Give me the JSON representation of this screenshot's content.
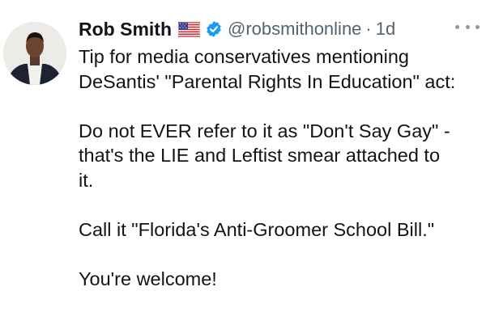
{
  "tweet": {
    "author": {
      "display_name": "Rob Smith",
      "flag_icon": "us-flag-icon",
      "verified_icon": "verified-badge-icon",
      "handle": "@robsmithonline",
      "separator": "·",
      "timestamp": "1d"
    },
    "more_icon": "more-options-icon",
    "body": {
      "line1": "Tip for media conservatives mentioning",
      "line2": "DeSantis' \"Parental Rights In Education\" act:",
      "line3": "Do not EVER refer to it as \"Don't Say Gay\" -",
      "line4": "that's the LIE and Leftist smear attached to",
      "line5": "it.",
      "line6": "Call it \"Florida's Anti-Groomer School Bill.\"",
      "line7": "You're welcome!"
    },
    "colors": {
      "text": "#0f1419",
      "secondary": "#536471",
      "verified": "#1d9bf0"
    }
  }
}
